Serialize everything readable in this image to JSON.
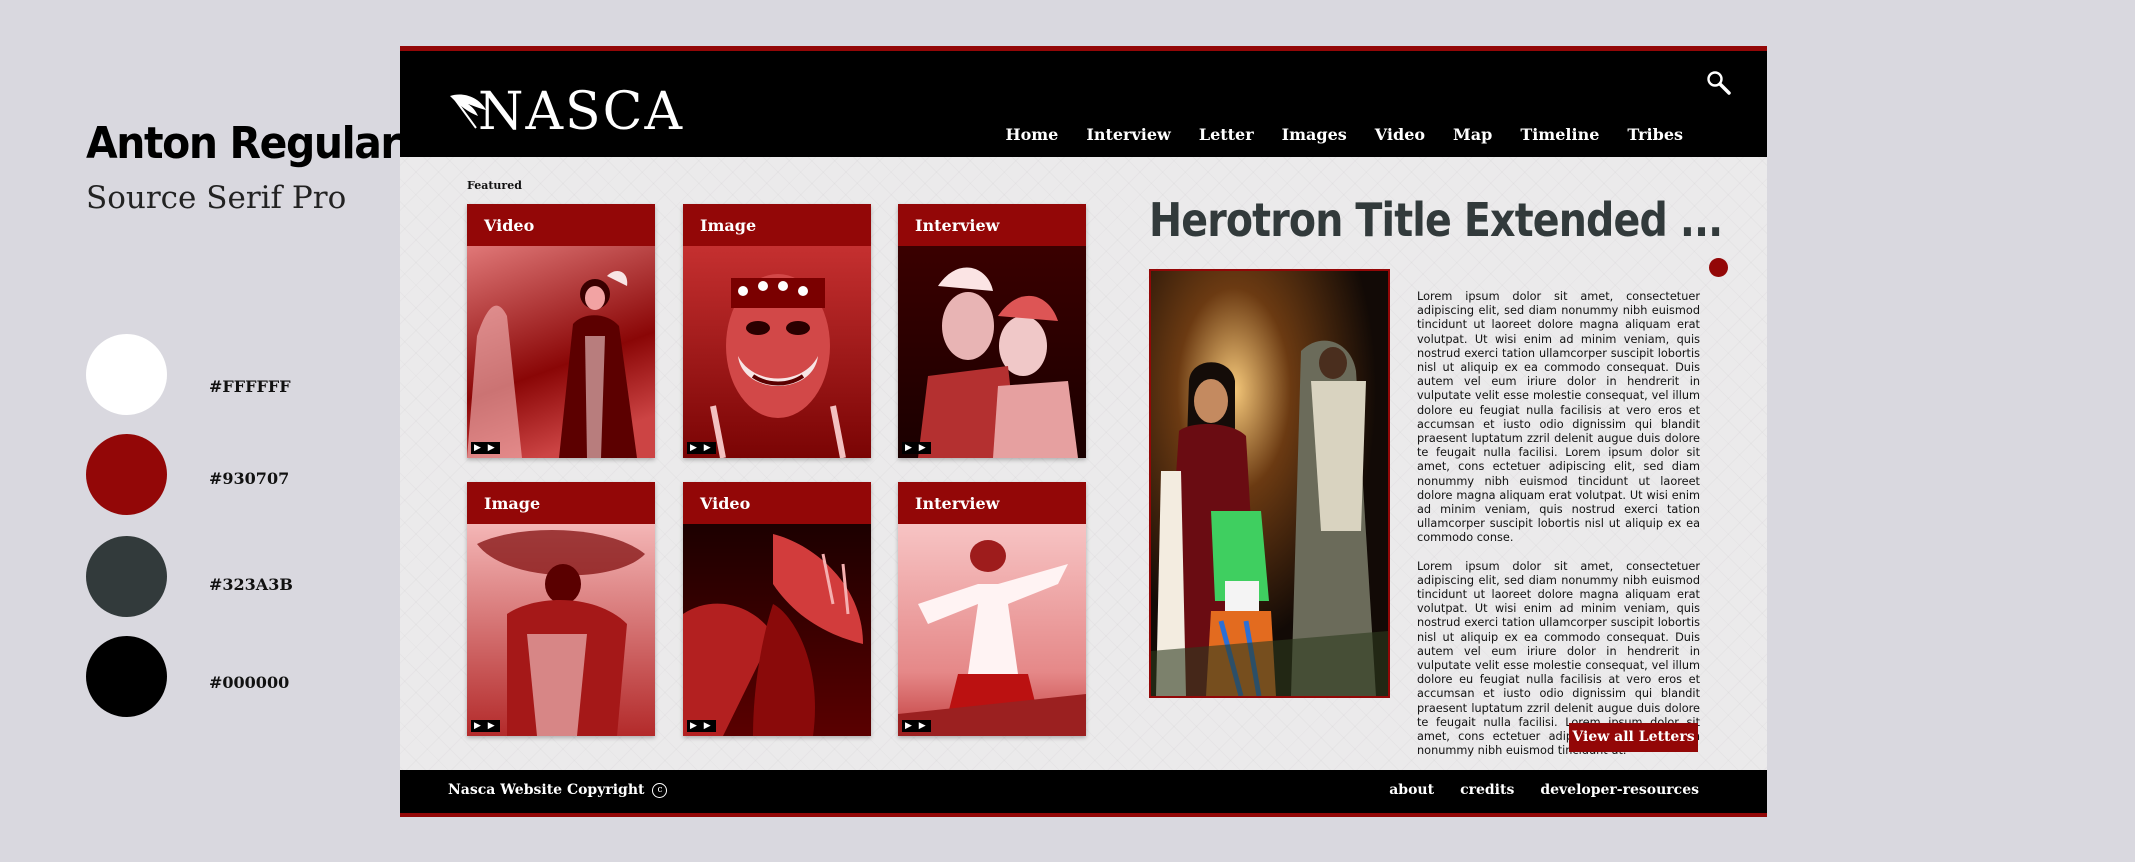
{
  "style_guide": {
    "font_primary": "Anton Regular",
    "font_secondary": "Source Serif Pro",
    "swatches": [
      {
        "hex": "#FFFFFF",
        "label": "#FFFFFF"
      },
      {
        "hex": "#930707",
        "label": "#930707"
      },
      {
        "hex": "#323A3B",
        "label": "#323A3B"
      },
      {
        "hex": "#000000",
        "label": "#000000"
      }
    ]
  },
  "header": {
    "logo_text": "NASCA",
    "nav": [
      "Home",
      "Interview",
      "Letter",
      "Images",
      "Video",
      "Map",
      "Timeline",
      "Tribes"
    ]
  },
  "featured": {
    "label": "Featured",
    "cards": [
      {
        "type": "Video"
      },
      {
        "type": "Image"
      },
      {
        "type": "Interview"
      },
      {
        "type": "Image"
      },
      {
        "type": "Video"
      },
      {
        "type": "Interview"
      }
    ],
    "play_glyph": "▶ ▶"
  },
  "hero": {
    "title": "Herotron Title Extended ...",
    "body": [
      "Lorem ipsum dolor sit amet, consectetuer adipiscing elit, sed diam nonummy nibh euismod tincidunt ut laoreet dolore magna aliquam erat volutpat. Ut wisi enim ad minim veniam, quis nostrud exerci tation ullamcorper suscipit lobortis nisl ut aliquip ex ea commodo consequat. Duis autem vel eum iriure dolor in hendrerit in vulputate velit esse molestie consequat, vel illum dolore eu feugiat nulla facilisis at vero eros et accumsan et iusto odio dignissim qui blandit praesent luptatum zzril delenit augue duis dolore te feugait nulla facilisi. Lorem ipsum dolor sit amet, cons ectetuer adipiscing elit, sed diam nonummy nibh euismod tincidunt ut laoreet dolore magna aliquam erat volutpat. Ut wisi enim ad minim veniam, quis nostrud exerci tation ullamcorper suscipit lobortis nisl ut aliquip ex ea commodo conse.",
      "Lorem ipsum dolor sit amet, consectetuer adipiscing elit, sed diam nonummy nibh euismod tincidunt ut laoreet dolore magna aliquam erat volutpat. Ut wisi enim ad minim veniam, quis nostrud exerci tation ullamcorper suscipit lobortis nisl ut aliquip ex ea commodo consequat. Duis autem vel eum iriure dolor in hendrerit in vulputate velit esse molestie consequat, vel illum dolore eu feugiat nulla facilisis at vero eros et accumsan et iusto odio dignissim qui blandit praesent luptatum zzril delenit augue duis dolore te feugait nulla facilisi. Lorem ipsum dolor sit amet, cons ectetuer adipiscing elit, sed diam nonummy nibh euismod tincidunt ut."
    ],
    "button": "View all Letters"
  },
  "footer": {
    "copyright": "Nasca Website Copyright",
    "copyright_glyph": "c",
    "links": [
      "about",
      "credits",
      "developer-resources"
    ]
  },
  "colors": {
    "accent": "#930707",
    "dark": "#323A3B",
    "black": "#000000",
    "white": "#FFFFFF"
  }
}
